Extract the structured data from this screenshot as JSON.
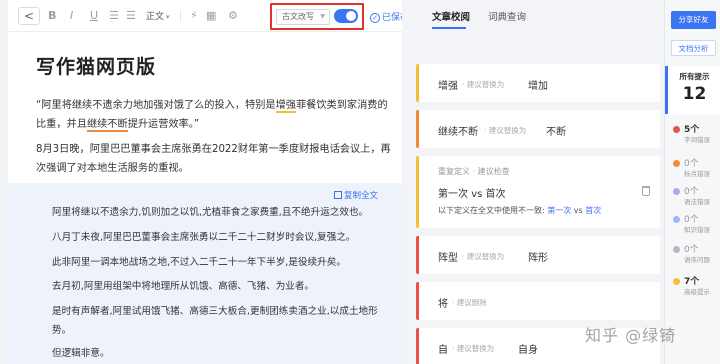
{
  "editor": {
    "toolbar": {
      "back": "<",
      "bold": "B",
      "italic": "I",
      "underline": "U",
      "list1": "☰",
      "list2": "☰",
      "font_size": "正文",
      "flash_icon": "⚡",
      "format_icon": "▦",
      "settings_icon": "⚙",
      "mode_select": "古文改写",
      "toggle_on": true,
      "saved": "已保存"
    },
    "title": "写作猫网页版",
    "paragraphs": {
      "p1_a": "“阿里将继续不遗余力地加强对饿了么的投入，特别是",
      "p1_u1": "增强",
      "p1_b": "菲餐饮类到家消费的比重，并且",
      "p1_u2": "继续不断",
      "p1_c": "提升运营效率。”",
      "p2": "8月3日晚，阿里巴巴董事会主席张勇在2022财年第一季度财报电话会议上，再次强调了对本地生活服务的重视。"
    },
    "rewrite": {
      "copy_all": "复制全文",
      "lines": [
        "阿里将继以不遗余力,饥则加之以饥,尤植菲食之家费重,且不绝升运之效也。",
        "八月丁未夜,阿里巴巴董事会主席张勇以二千二十二财岁时会议,复强之。",
        "此非阿里一调本地战场之地,不过入二千二十一年下半岁,是役续升矣。",
        "去月初,阿里用组架中将地理所从饥饿、高德、飞猪、为业者。",
        "是时有声解者,阿里试用饿飞猪、高德三大板合,更制团练卖酒之业,以成土地形势。",
        "但逻辑非意。"
      ]
    }
  },
  "review": {
    "tabs": [
      "文章校阅",
      "词典查询"
    ],
    "cards": [
      {
        "word": "增强",
        "hint": "· 建议替换为",
        "target": "增加"
      },
      {
        "word": "继续不断",
        "hint": "· 建议替换为",
        "target": "不断"
      },
      {
        "sub": "重复定义 · 建议检查",
        "line_a": "第一次",
        "vs": "vs",
        "line_b": "首次",
        "note_a": "以下定义在全文中使用不一致:",
        "note_b": "第一次",
        "note_vs": "vs",
        "note_c": "首次"
      },
      {
        "word": "阵型",
        "hint": "· 建议替换为",
        "target": "阵形"
      },
      {
        "word": "将",
        "hint": "· 建议删除",
        "target": ""
      },
      {
        "word": "自",
        "hint": "· 建议替换为",
        "target": "自身"
      }
    ]
  },
  "sidebar": {
    "share": "分享好友",
    "analysis": "文档分析",
    "total_label": "所有提示",
    "total": "12",
    "stats": [
      {
        "count": "5个",
        "name": "字词错误",
        "color": "#e5534b"
      },
      {
        "count": "0个",
        "name": "标点错误",
        "color": "#f08a3c"
      },
      {
        "count": "0个",
        "name": "语法错误",
        "color": "#b9a2e8"
      },
      {
        "count": "0个",
        "name": "知识错误",
        "color": "#9fb8f5"
      },
      {
        "count": "0个",
        "name": "语序问题",
        "color": "#b5b8bf"
      },
      {
        "count": "7个",
        "name": "高级提示",
        "color": "#f2c037"
      }
    ]
  },
  "watermark": "知乎 @绿锜"
}
